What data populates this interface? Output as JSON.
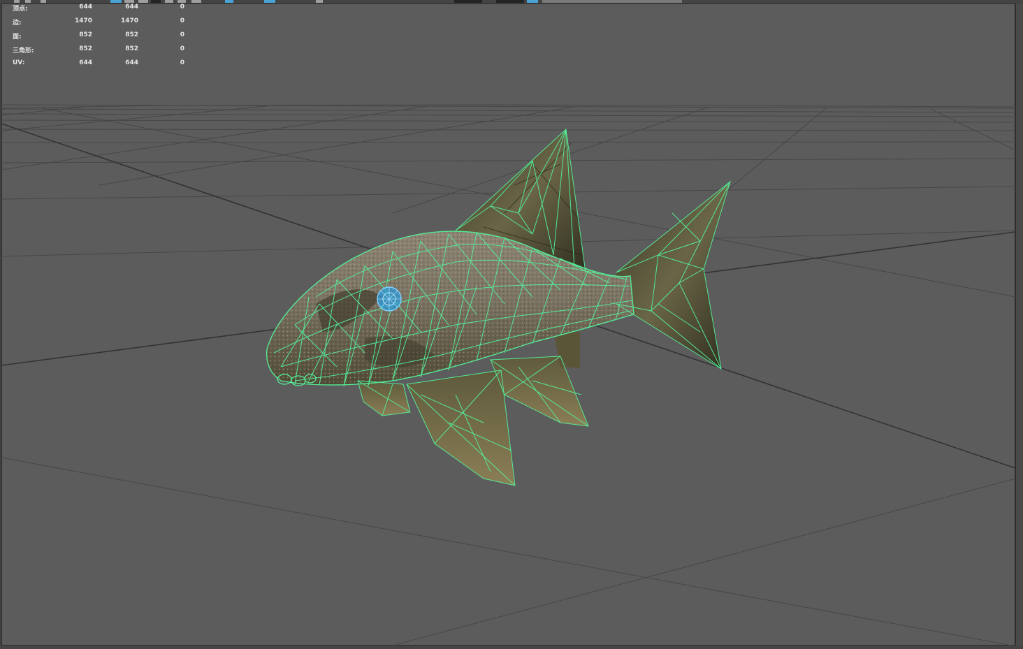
{
  "hud": {
    "rows": [
      {
        "label": "顶点:",
        "v1": "644",
        "v2": "644",
        "v3": "0"
      },
      {
        "label": "边:",
        "v1": "1470",
        "v2": "1470",
        "v3": "0"
      },
      {
        "label": "面:",
        "v1": "852",
        "v2": "852",
        "v3": "0"
      },
      {
        "label": "三角形:",
        "v1": "852",
        "v2": "852",
        "v3": "0"
      },
      {
        "label": "UV:",
        "v1": "644",
        "v2": "644",
        "v3": "0"
      }
    ]
  },
  "toolbar": {
    "icons": [
      "select-icon",
      "lasso-icon",
      "paint-select-icon",
      "wireframe-icon",
      "smooth-shade-icon",
      "textured-icon",
      "lights-icon",
      "shadows-icon",
      "isolate-icon",
      "xray-icon",
      "resolution-gate-icon",
      "camera-icon"
    ]
  },
  "scene": {
    "object": "fish-mesh",
    "wireframe_color": "#55f09a",
    "eye_color": "#4fb4ff",
    "grid_color": "#3f3f3f",
    "background_color": "#5c5c5c"
  }
}
